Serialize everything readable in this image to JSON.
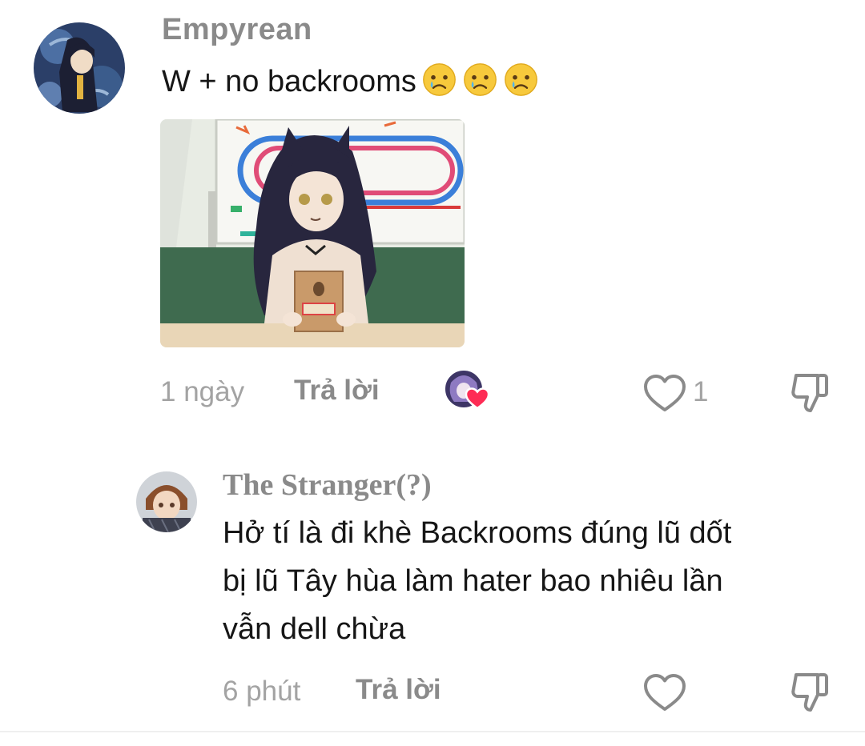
{
  "comments": [
    {
      "username": "Empyrean",
      "text": "W + no backrooms",
      "emojis": [
        "crying-face",
        "crying-face",
        "crying-face"
      ],
      "time": "1 ngày",
      "reply_label": "Trả lời",
      "like_count": "1",
      "has_creator_like": true
    },
    {
      "username": "The Stranger(?)",
      "text_lines": [
        "Hở tí là đi khè Backrooms đúng lũ dốt",
        "bị lũ Tây hùa làm hater bao nhiêu lần",
        "vẫn dell chừa"
      ],
      "time": "6 phút",
      "reply_label": "Trả lời"
    }
  ],
  "colors": {
    "username": "#8a8a8a",
    "text": "#161616",
    "meta": "#a3a3a3",
    "heart_badge": "#fe2c55"
  },
  "icons": {
    "like": "heart-outline-icon",
    "dislike": "thumbs-down-icon",
    "creator_liked": "heart-filled-icon"
  }
}
